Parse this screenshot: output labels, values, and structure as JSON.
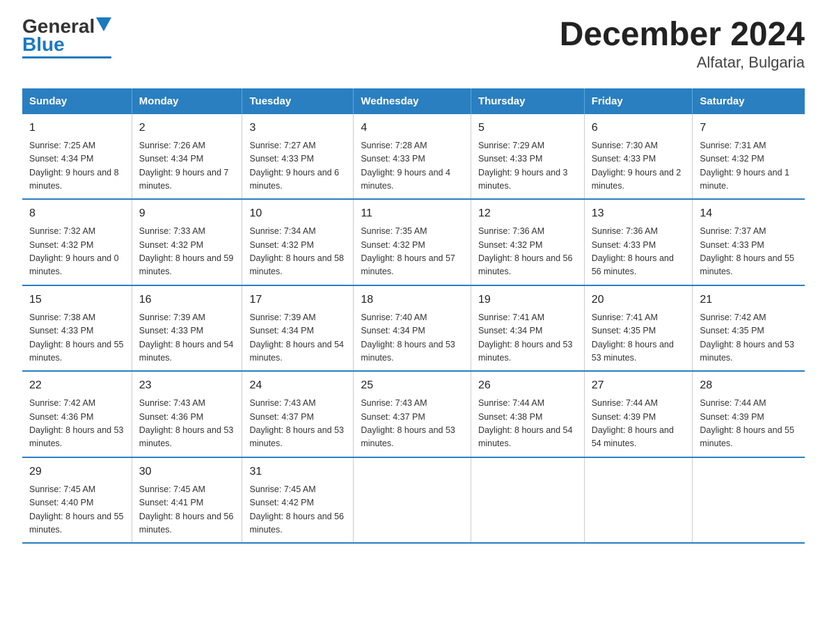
{
  "logo": {
    "general": "General",
    "blue": "Blue"
  },
  "title": "December 2024",
  "subtitle": "Alfatar, Bulgaria",
  "days_of_week": [
    "Sunday",
    "Monday",
    "Tuesday",
    "Wednesday",
    "Thursday",
    "Friday",
    "Saturday"
  ],
  "weeks": [
    [
      {
        "day": "1",
        "sunrise": "Sunrise: 7:25 AM",
        "sunset": "Sunset: 4:34 PM",
        "daylight": "Daylight: 9 hours and 8 minutes."
      },
      {
        "day": "2",
        "sunrise": "Sunrise: 7:26 AM",
        "sunset": "Sunset: 4:34 PM",
        "daylight": "Daylight: 9 hours and 7 minutes."
      },
      {
        "day": "3",
        "sunrise": "Sunrise: 7:27 AM",
        "sunset": "Sunset: 4:33 PM",
        "daylight": "Daylight: 9 hours and 6 minutes."
      },
      {
        "day": "4",
        "sunrise": "Sunrise: 7:28 AM",
        "sunset": "Sunset: 4:33 PM",
        "daylight": "Daylight: 9 hours and 4 minutes."
      },
      {
        "day": "5",
        "sunrise": "Sunrise: 7:29 AM",
        "sunset": "Sunset: 4:33 PM",
        "daylight": "Daylight: 9 hours and 3 minutes."
      },
      {
        "day": "6",
        "sunrise": "Sunrise: 7:30 AM",
        "sunset": "Sunset: 4:33 PM",
        "daylight": "Daylight: 9 hours and 2 minutes."
      },
      {
        "day": "7",
        "sunrise": "Sunrise: 7:31 AM",
        "sunset": "Sunset: 4:32 PM",
        "daylight": "Daylight: 9 hours and 1 minute."
      }
    ],
    [
      {
        "day": "8",
        "sunrise": "Sunrise: 7:32 AM",
        "sunset": "Sunset: 4:32 PM",
        "daylight": "Daylight: 9 hours and 0 minutes."
      },
      {
        "day": "9",
        "sunrise": "Sunrise: 7:33 AM",
        "sunset": "Sunset: 4:32 PM",
        "daylight": "Daylight: 8 hours and 59 minutes."
      },
      {
        "day": "10",
        "sunrise": "Sunrise: 7:34 AM",
        "sunset": "Sunset: 4:32 PM",
        "daylight": "Daylight: 8 hours and 58 minutes."
      },
      {
        "day": "11",
        "sunrise": "Sunrise: 7:35 AM",
        "sunset": "Sunset: 4:32 PM",
        "daylight": "Daylight: 8 hours and 57 minutes."
      },
      {
        "day": "12",
        "sunrise": "Sunrise: 7:36 AM",
        "sunset": "Sunset: 4:32 PM",
        "daylight": "Daylight: 8 hours and 56 minutes."
      },
      {
        "day": "13",
        "sunrise": "Sunrise: 7:36 AM",
        "sunset": "Sunset: 4:33 PM",
        "daylight": "Daylight: 8 hours and 56 minutes."
      },
      {
        "day": "14",
        "sunrise": "Sunrise: 7:37 AM",
        "sunset": "Sunset: 4:33 PM",
        "daylight": "Daylight: 8 hours and 55 minutes."
      }
    ],
    [
      {
        "day": "15",
        "sunrise": "Sunrise: 7:38 AM",
        "sunset": "Sunset: 4:33 PM",
        "daylight": "Daylight: 8 hours and 55 minutes."
      },
      {
        "day": "16",
        "sunrise": "Sunrise: 7:39 AM",
        "sunset": "Sunset: 4:33 PM",
        "daylight": "Daylight: 8 hours and 54 minutes."
      },
      {
        "day": "17",
        "sunrise": "Sunrise: 7:39 AM",
        "sunset": "Sunset: 4:34 PM",
        "daylight": "Daylight: 8 hours and 54 minutes."
      },
      {
        "day": "18",
        "sunrise": "Sunrise: 7:40 AM",
        "sunset": "Sunset: 4:34 PM",
        "daylight": "Daylight: 8 hours and 53 minutes."
      },
      {
        "day": "19",
        "sunrise": "Sunrise: 7:41 AM",
        "sunset": "Sunset: 4:34 PM",
        "daylight": "Daylight: 8 hours and 53 minutes."
      },
      {
        "day": "20",
        "sunrise": "Sunrise: 7:41 AM",
        "sunset": "Sunset: 4:35 PM",
        "daylight": "Daylight: 8 hours and 53 minutes."
      },
      {
        "day": "21",
        "sunrise": "Sunrise: 7:42 AM",
        "sunset": "Sunset: 4:35 PM",
        "daylight": "Daylight: 8 hours and 53 minutes."
      }
    ],
    [
      {
        "day": "22",
        "sunrise": "Sunrise: 7:42 AM",
        "sunset": "Sunset: 4:36 PM",
        "daylight": "Daylight: 8 hours and 53 minutes."
      },
      {
        "day": "23",
        "sunrise": "Sunrise: 7:43 AM",
        "sunset": "Sunset: 4:36 PM",
        "daylight": "Daylight: 8 hours and 53 minutes."
      },
      {
        "day": "24",
        "sunrise": "Sunrise: 7:43 AM",
        "sunset": "Sunset: 4:37 PM",
        "daylight": "Daylight: 8 hours and 53 minutes."
      },
      {
        "day": "25",
        "sunrise": "Sunrise: 7:43 AM",
        "sunset": "Sunset: 4:37 PM",
        "daylight": "Daylight: 8 hours and 53 minutes."
      },
      {
        "day": "26",
        "sunrise": "Sunrise: 7:44 AM",
        "sunset": "Sunset: 4:38 PM",
        "daylight": "Daylight: 8 hours and 54 minutes."
      },
      {
        "day": "27",
        "sunrise": "Sunrise: 7:44 AM",
        "sunset": "Sunset: 4:39 PM",
        "daylight": "Daylight: 8 hours and 54 minutes."
      },
      {
        "day": "28",
        "sunrise": "Sunrise: 7:44 AM",
        "sunset": "Sunset: 4:39 PM",
        "daylight": "Daylight: 8 hours and 55 minutes."
      }
    ],
    [
      {
        "day": "29",
        "sunrise": "Sunrise: 7:45 AM",
        "sunset": "Sunset: 4:40 PM",
        "daylight": "Daylight: 8 hours and 55 minutes."
      },
      {
        "day": "30",
        "sunrise": "Sunrise: 7:45 AM",
        "sunset": "Sunset: 4:41 PM",
        "daylight": "Daylight: 8 hours and 56 minutes."
      },
      {
        "day": "31",
        "sunrise": "Sunrise: 7:45 AM",
        "sunset": "Sunset: 4:42 PM",
        "daylight": "Daylight: 8 hours and 56 minutes."
      },
      {
        "day": "",
        "sunrise": "",
        "sunset": "",
        "daylight": ""
      },
      {
        "day": "",
        "sunrise": "",
        "sunset": "",
        "daylight": ""
      },
      {
        "day": "",
        "sunrise": "",
        "sunset": "",
        "daylight": ""
      },
      {
        "day": "",
        "sunrise": "",
        "sunset": "",
        "daylight": ""
      }
    ]
  ]
}
